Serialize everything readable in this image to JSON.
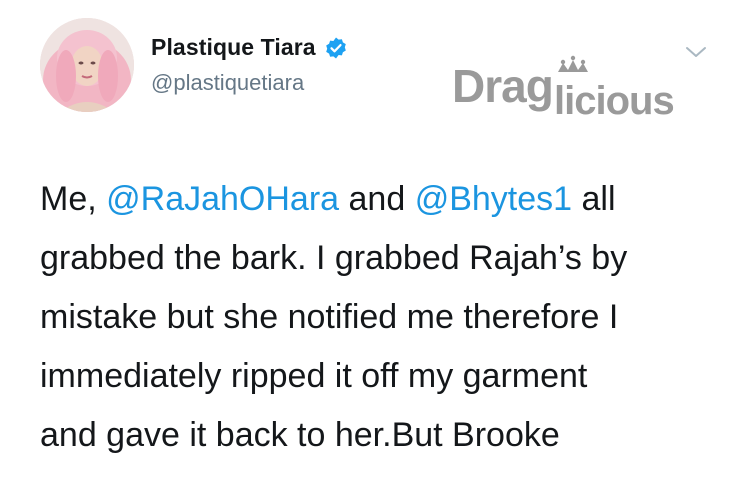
{
  "author": {
    "display_name": "Plastique Tiara",
    "handle": "@plastiquetiara",
    "verified": true,
    "avatar": "profile-photo"
  },
  "watermark": {
    "text": "Draglicious",
    "color": "#9a9a9a"
  },
  "tweet": {
    "line1": {
      "t1": "Me, ",
      "m1": "@RaJahOHara",
      "t2": " and ",
      "m2": "@Bhytes1",
      "t3": " all"
    },
    "line2": "grabbed the bark. I grabbed Rajah’s by",
    "line3": "mistake but she notified me therefore I",
    "line4": "immediately ripped it off my garment",
    "line5": "and gave it back to her.But Brooke"
  },
  "colors": {
    "mention": "#1b95e0",
    "verified": "#1da1f2",
    "text": "#14171a",
    "secondary": "#657786"
  },
  "icons": [
    "verified-badge-icon",
    "chevron-down-icon"
  ]
}
